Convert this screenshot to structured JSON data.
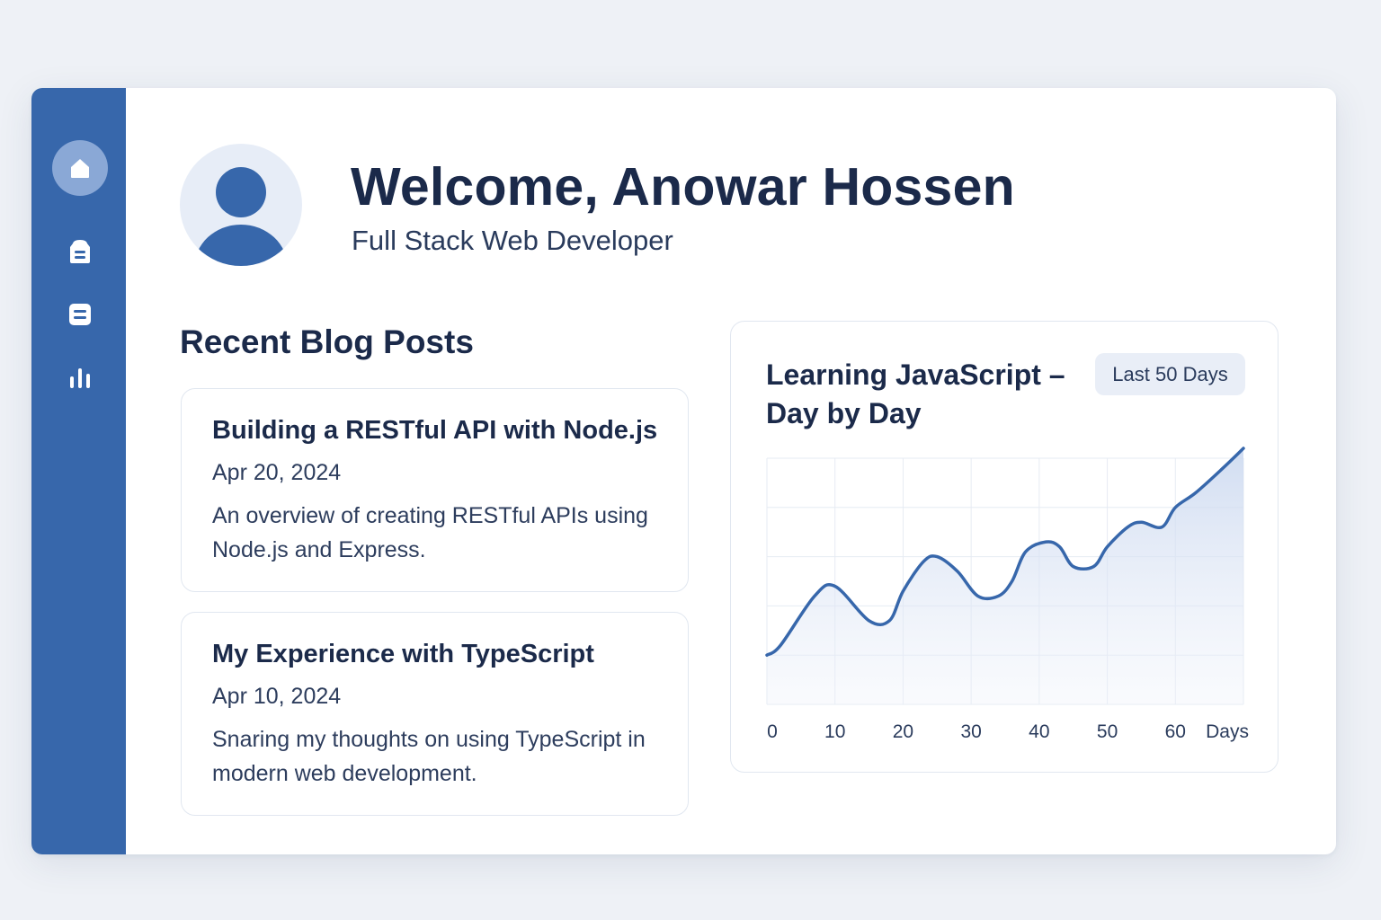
{
  "user": {
    "welcome": "Welcome, Anowar Hossen",
    "role": "Full Stack Web Developer"
  },
  "sidebar": {
    "items": [
      {
        "icon": "home-icon",
        "active": true
      },
      {
        "icon": "archive-icon",
        "active": false
      },
      {
        "icon": "list-icon",
        "active": false
      },
      {
        "icon": "chart-icon",
        "active": false
      }
    ]
  },
  "blog": {
    "section_title": "Recent Blog Posts",
    "posts": [
      {
        "title": "Building a RESTful API with Node.js",
        "date": "Apr 20, 2024",
        "description": "An overview of creating RESTful APIs using Node.js and Express."
      },
      {
        "title": "My Experience with TypeScript",
        "date": "Apr 10, 2024",
        "description": "Snaring my thoughts on using TypeScript in modern web development."
      }
    ]
  },
  "chart_panel": {
    "title": "Learning JavaScript – Day by Day",
    "range_label": "Last 50 Days"
  },
  "colors": {
    "sidebar": "#3767ab",
    "accent": "#3767ab",
    "text": "#1b2a4a"
  },
  "chart_data": {
    "type": "area",
    "title": "Learning JavaScript – Day by Day",
    "xlabel": "Days",
    "ylabel": "",
    "x_ticks": [
      "0",
      "10",
      "20",
      "30",
      "40",
      "50",
      "60"
    ],
    "xlim": [
      0,
      70
    ],
    "ylim": [
      0,
      5
    ],
    "grid": true,
    "series": [
      {
        "x": [
          0,
          2,
          7,
          10,
          15,
          18,
          20,
          23,
          25,
          28,
          31,
          34,
          36,
          38,
          41,
          43,
          45,
          48,
          50,
          53,
          55,
          58,
          60,
          63,
          67,
          70
        ],
        "y": [
          1.0,
          1.2,
          2.2,
          2.4,
          1.7,
          1.7,
          2.3,
          2.9,
          3.0,
          2.7,
          2.2,
          2.2,
          2.5,
          3.1,
          3.3,
          3.2,
          2.8,
          2.8,
          3.2,
          3.6,
          3.7,
          3.6,
          4.0,
          4.3,
          4.8,
          5.2
        ]
      }
    ]
  }
}
